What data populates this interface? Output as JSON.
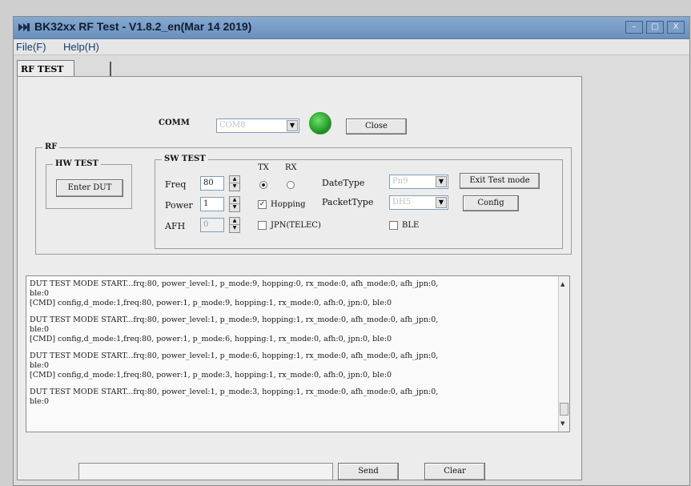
{
  "window": {
    "title": "BK32xx RF Test - V1.8.2_en(Mar 14 2019)",
    "controls": [
      "–",
      "□",
      "X"
    ]
  },
  "menu": [
    "File(F)",
    "Help(H)"
  ],
  "tab": {
    "active": "RF TEST"
  },
  "comm": {
    "label": "COMM",
    "port": "COM8",
    "close_label": "Close",
    "status_color": "#2aa52f"
  },
  "rf": {
    "title": "RF",
    "hw_test": {
      "title": "HW TEST",
      "enter_dut_label": "Enter DUT"
    },
    "sw_test": {
      "title": "SW TEST",
      "freq_label": "Freq",
      "freq_value": "80",
      "power_label": "Power",
      "power_value": "1",
      "afh_label": "AFH",
      "afh_value": "0",
      "tx_label": "TX",
      "rx_label": "RX",
      "selected_mode": "TX",
      "hopping_label": "Hopping",
      "hopping_checked": true,
      "jpn_label": "JPN(TELEC)",
      "jpn_checked": false,
      "datetype_label": "DateType",
      "datetype_value": "Pn9",
      "packettype_label": "PacketType",
      "packettype_value": "DH5",
      "ble_label": "BLE",
      "ble_checked": false,
      "exit_test_mode_label": "Exit Test mode",
      "config_label": "Config"
    }
  },
  "log": {
    "lines": [
      "DUT TEST MODE START...frq:80, power_level:1, p_mode:9, hopping:0, rx_mode:0, afh_mode:0, afh_jpn:0,",
      "ble:0",
      "[CMD] config,d_mode:1,freq:80, power:1, p_mode:9, hopping:1, rx_mode:0, afh:0, jpn:0, ble:0",
      "",
      "DUT TEST MODE START...frq:80, power_level:1, p_mode:9, hopping:1, rx_mode:0, afh_mode:0, afh_jpn:0,",
      "ble:0",
      "[CMD] config,d_mode:1,freq:80, power:1, p_mode:6, hopping:1, rx_mode:0, afh:0, jpn:0, ble:0",
      "",
      "DUT TEST MODE START...frq:80, power_level:1, p_mode:6, hopping:1, rx_mode:0, afh_mode:0, afh_jpn:0,",
      "ble:0",
      "[CMD] config,d_mode:1,freq:80, power:1, p_mode:3, hopping:1, rx_mode:0, afh:0, jpn:0, ble:0",
      "",
      "DUT TEST MODE START...frq:80, power_level:1, p_mode:3, hopping:1, rx_mode:0, afh_mode:0, afh_jpn:0,",
      "ble:0"
    ]
  },
  "bottom": {
    "send_label": "Send",
    "clear_label": "Clear",
    "input_value": ""
  }
}
